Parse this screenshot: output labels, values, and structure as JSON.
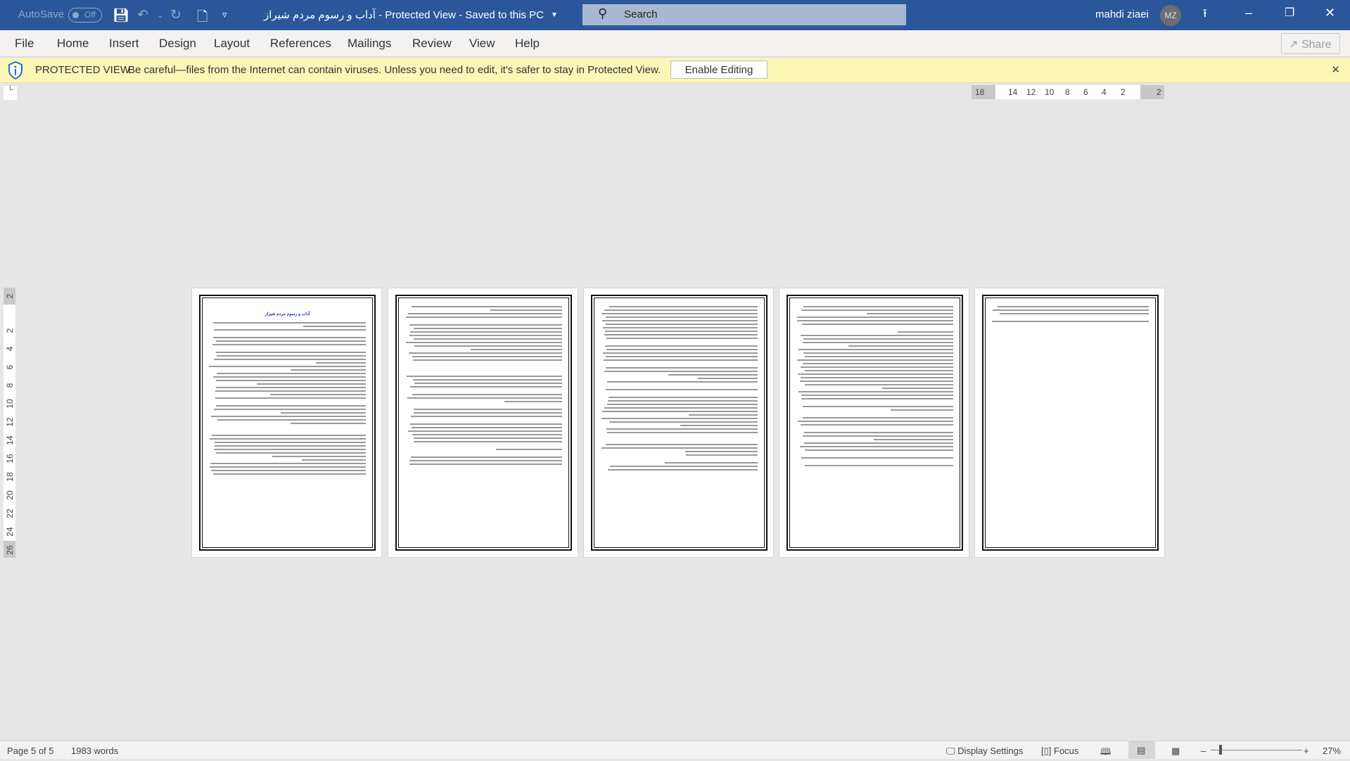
{
  "titlebar": {
    "autosave_label": "AutoSave",
    "autosave_state": "Off",
    "document_title": "آداب و رسوم مردم شیراز  -  Protected View  -  Saved to this PC",
    "search_placeholder": "Search",
    "user_name": "mahdi ziaei",
    "user_initials": "MZ"
  },
  "menu": {
    "items": [
      "File",
      "Home",
      "Insert",
      "Design",
      "Layout",
      "References",
      "Mailings",
      "Review",
      "View",
      "Help"
    ],
    "share_label": "Share"
  },
  "protected_view": {
    "label": "PROTECTED VIEW",
    "message": "Be careful—files from the Internet can contain viruses. Unless you need to edit, it's safer to stay in Protected View.",
    "enable_button": "Enable Editing"
  },
  "rulers": {
    "horizontal": [
      "18",
      "14",
      "12",
      "10",
      "8",
      "6",
      "4",
      "2",
      "2"
    ],
    "vertical": [
      "2",
      "2",
      "4",
      "6",
      "8",
      "10",
      "12",
      "14",
      "16",
      "18",
      "20",
      "22",
      "24",
      "26"
    ]
  },
  "document": {
    "page1_title": "آداب و رسوم مردم شیراز",
    "page_count": 5
  },
  "status": {
    "page": "Page 5 of 5",
    "words": "1983 words",
    "display_settings": "Display Settings",
    "focus": "Focus",
    "zoom": "27%",
    "zoom_percent": 27
  },
  "colors": {
    "titlebar": "#2b579a",
    "protected_bar": "#fcf7b6",
    "title_blue": "#1f2bd8"
  }
}
